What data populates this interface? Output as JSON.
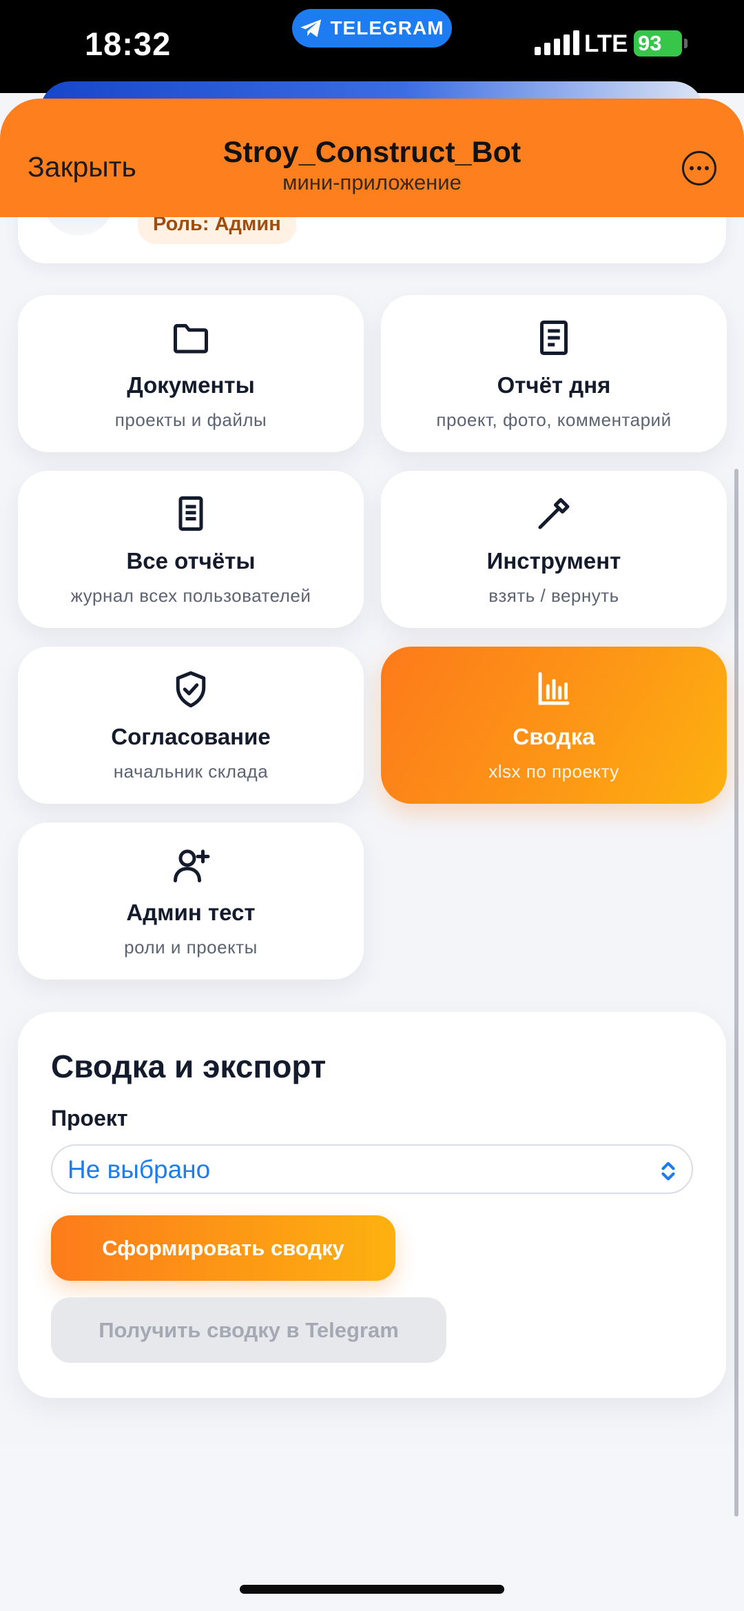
{
  "status_bar": {
    "time": "18:32",
    "app_pill": "TELEGRAM",
    "network": "LTE",
    "battery": "93"
  },
  "header": {
    "close_label": "Закрыть",
    "title": "Stroy_Construct_Bot",
    "subtitle": "мини-приложение",
    "accent_color": "#fd7f1e"
  },
  "profile": {
    "role": "Роль: Админ"
  },
  "tiles": [
    {
      "title": "Документы",
      "subtitle": "проекты и файлы",
      "icon": "folder-icon"
    },
    {
      "title": "Отчёт дня",
      "subtitle": "проект, фото, комментарий",
      "icon": "report-icon"
    },
    {
      "title": "Все отчёты",
      "subtitle": "журнал всех пользователей",
      "icon": "document-list-icon"
    },
    {
      "title": "Инструмент",
      "subtitle": "взять / вернуть",
      "icon": "tool-icon"
    },
    {
      "title": "Согласование",
      "subtitle": "начальник склада",
      "icon": "shield-check-icon"
    },
    {
      "title": "Сводка",
      "subtitle": "xlsx по проекту",
      "icon": "bar-chart-icon",
      "active": true
    },
    {
      "title": "Админ тест",
      "subtitle": "роли и проекты",
      "icon": "user-add-icon"
    }
  ],
  "summary": {
    "title": "Сводка и экспорт",
    "project_label": "Проект",
    "project_value": "Не выбрано",
    "generate_button": "Сформировать сводку",
    "telegram_button": "Получить сводку в Telegram"
  }
}
